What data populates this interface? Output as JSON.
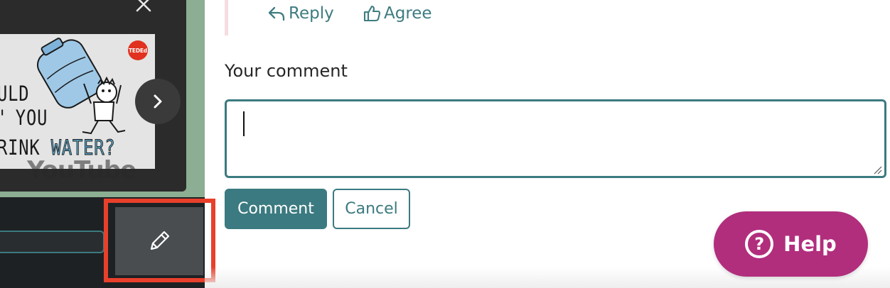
{
  "video_panel": {
    "close_icon": "close-icon",
    "thumbnail": {
      "brand_badge": "TEDEd",
      "lines": [
        "ULD",
        "YOU",
        "RINK"
      ],
      "highlight_word": "WATER?",
      "watermark": "YouTube"
    },
    "next_icon": "chevron-right-icon",
    "edit_icon": "pencil-icon"
  },
  "comment_actions": {
    "reply_label": "Reply",
    "agree_label": "Agree"
  },
  "comment_form": {
    "label": "Your comment",
    "value": "",
    "submit_label": "Comment",
    "cancel_label": "Cancel"
  },
  "help": {
    "icon": "?",
    "label": "Help"
  },
  "colors": {
    "accent": "#3b7a80",
    "help": "#b12e7d",
    "highlight": "#e8402b",
    "panel_green": "#8cae92"
  }
}
